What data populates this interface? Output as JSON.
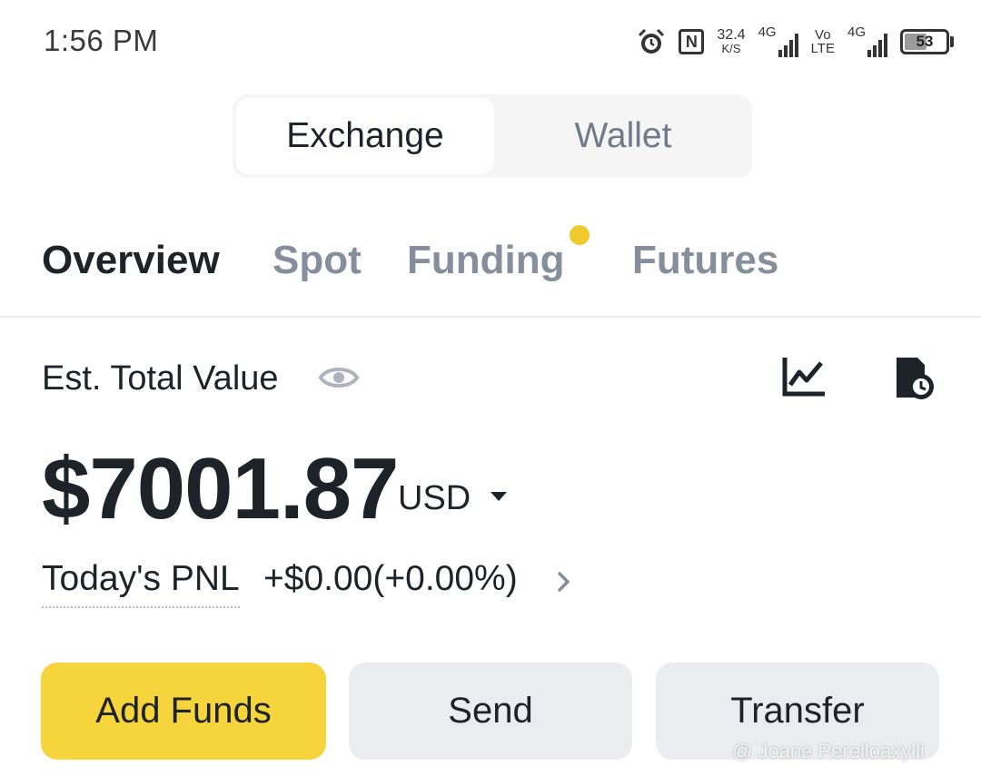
{
  "status_bar": {
    "time": "1:56 PM",
    "speed_value": "32.4",
    "speed_unit": "K/S",
    "network_1": "4G",
    "volte_line1": "Vo",
    "volte_line2": "LTE",
    "network_2": "4G",
    "battery_level": "53",
    "battery_fraction": 0.53,
    "icons": [
      "alarm-icon",
      "nfc-icon",
      "signal-icon",
      "battery-icon"
    ]
  },
  "segment": {
    "tabs": [
      {
        "label": "Exchange",
        "active": true
      },
      {
        "label": "Wallet",
        "active": false
      }
    ]
  },
  "subtabs": [
    {
      "label": "Overview",
      "active": true
    },
    {
      "label": "Spot",
      "active": false
    },
    {
      "label": "Funding",
      "active": false,
      "has_notification_dot": true
    },
    {
      "label": "Futures",
      "active": false
    }
  ],
  "balance": {
    "label": "Est. Total Value",
    "symbol": "$",
    "amount": "7001.87",
    "currency": "USD",
    "pnl_label": "Today's PNL",
    "pnl_value": "+$0.00(+0.00%)"
  },
  "actions": {
    "add_funds": "Add Funds",
    "send": "Send",
    "transfer": "Transfer"
  },
  "colors": {
    "accent": "#f5d43c",
    "notify_dot": "#f0c92e",
    "text_primary": "#1e2329",
    "text_secondary": "#848e9c",
    "button_secondary_bg": "#eaecef"
  },
  "watermark": "@ Joane Perelloaxylli"
}
